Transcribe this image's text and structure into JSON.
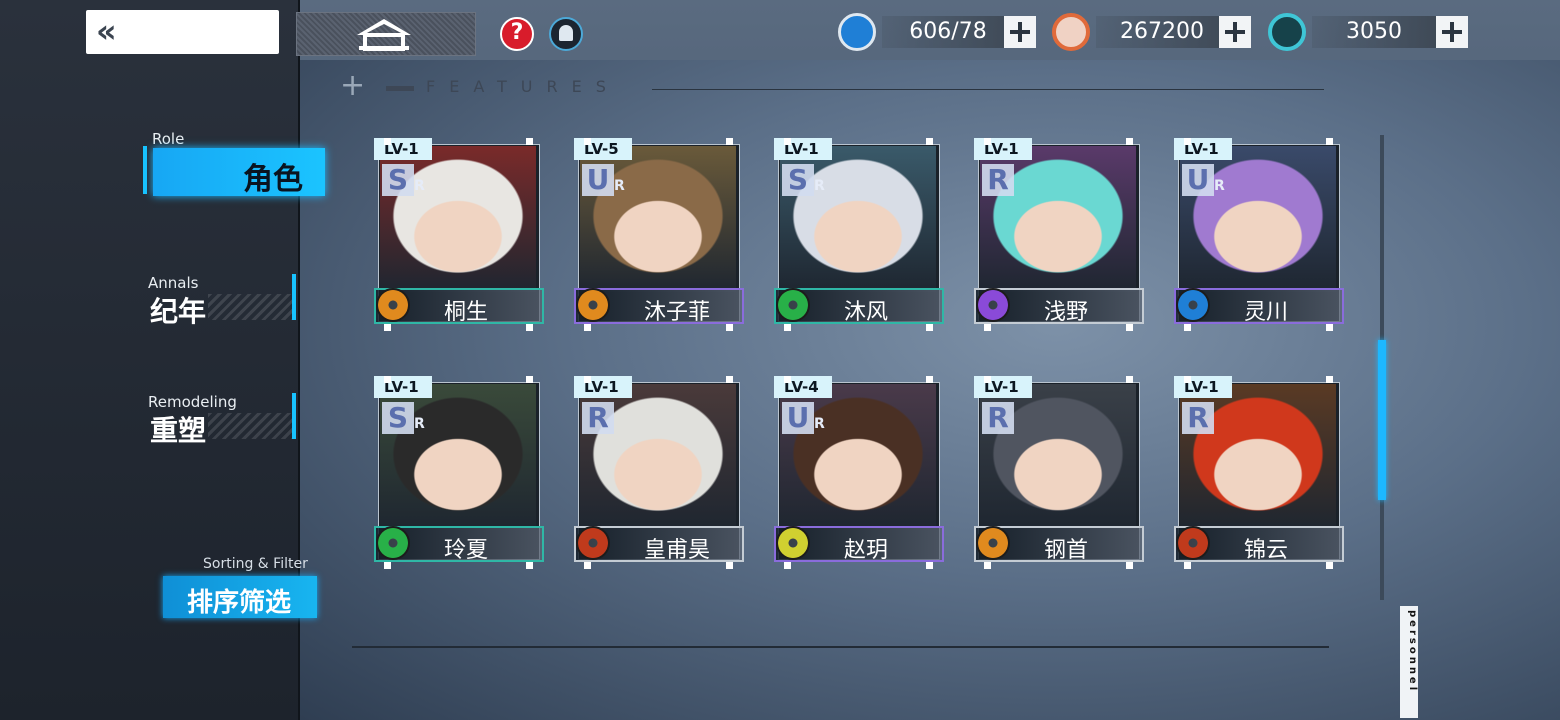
{
  "header": {
    "back_glyph": "«",
    "resources": [
      {
        "icon": "stamina-plus-icon",
        "value": "606/78",
        "color": "#1f7fd6"
      },
      {
        "icon": "gear-coin-icon",
        "value": "267200",
        "color": "#e06a3a"
      },
      {
        "icon": "crystal-icon",
        "value": "3050",
        "color": "#3fc6d6"
      }
    ]
  },
  "section": {
    "title": "FEATURES"
  },
  "nav": {
    "role": {
      "en": "Role",
      "cn": "角色"
    },
    "annals": {
      "en": "Annals",
      "cn": "纪年"
    },
    "remodeling": {
      "en": "Remodeling",
      "cn": "重塑"
    }
  },
  "sort": {
    "en": "Sorting & Filter",
    "cn": "排序筛选"
  },
  "characters": [
    {
      "level": "LV-1",
      "rank": "S",
      "rank_sub": "R",
      "name": "桐生",
      "element": "lightning-icon",
      "elem_color": "#e08a1e",
      "hair": "#e8e6e2",
      "bg": "#7a2a2a",
      "name_style": "teal"
    },
    {
      "level": "LV-5",
      "rank": "U",
      "rank_sub": "R",
      "name": "沐子菲",
      "element": "lightning-icon",
      "elem_color": "#e08a1e",
      "hair": "#8a6a48",
      "bg": "#6a5a3a",
      "name_style": "purple"
    },
    {
      "level": "LV-1",
      "rank": "S",
      "rank_sub": "R",
      "name": "沐风",
      "element": "wind-icon",
      "elem_color": "#28b048",
      "hair": "#d8dde6",
      "bg": "#3a5a6a",
      "name_style": "teal"
    },
    {
      "level": "LV-1",
      "rank": "R",
      "rank_sub": "",
      "name": "浅野",
      "element": "star-icon",
      "elem_color": "#8a4ad8",
      "hair": "#6ad8d2",
      "bg": "#5a3a6a",
      "name_style": "gray"
    },
    {
      "level": "LV-1",
      "rank": "U",
      "rank_sub": "R",
      "name": "灵川",
      "element": "water-icon",
      "elem_color": "#1f7fd6",
      "hair": "#a07ad0",
      "bg": "#3a4a6a",
      "name_style": "purple"
    },
    {
      "level": "LV-1",
      "rank": "S",
      "rank_sub": "R",
      "name": "玲夏",
      "element": "wind-icon",
      "elem_color": "#28b048",
      "hair": "#2a2a2a",
      "bg": "#3a4a3a",
      "name_style": "teal"
    },
    {
      "level": "LV-1",
      "rank": "R",
      "rank_sub": "",
      "name": "皇甫昊",
      "element": "fire-icon",
      "elem_color": "#c03a1c",
      "hair": "#e0e0dc",
      "bg": "#4a3a3a",
      "name_style": "gray"
    },
    {
      "level": "LV-4",
      "rank": "U",
      "rank_sub": "R",
      "name": "赵玥",
      "element": "light-icon",
      "elem_color": "#d0d030",
      "hair": "#4a3024",
      "bg": "#4a3a4a",
      "name_style": "purple"
    },
    {
      "level": "LV-1",
      "rank": "R",
      "rank_sub": "",
      "name": "钢首",
      "element": "lightning-icon",
      "elem_color": "#e08a1e",
      "hair": "#505560",
      "bg": "#3a4048",
      "name_style": "gray"
    },
    {
      "level": "LV-1",
      "rank": "R",
      "rank_sub": "",
      "name": "锦云",
      "element": "fire-icon",
      "elem_color": "#c03a1c",
      "hair": "#d0381c",
      "bg": "#5a3a24",
      "name_style": "gray"
    }
  ],
  "side_tag": "personnel"
}
